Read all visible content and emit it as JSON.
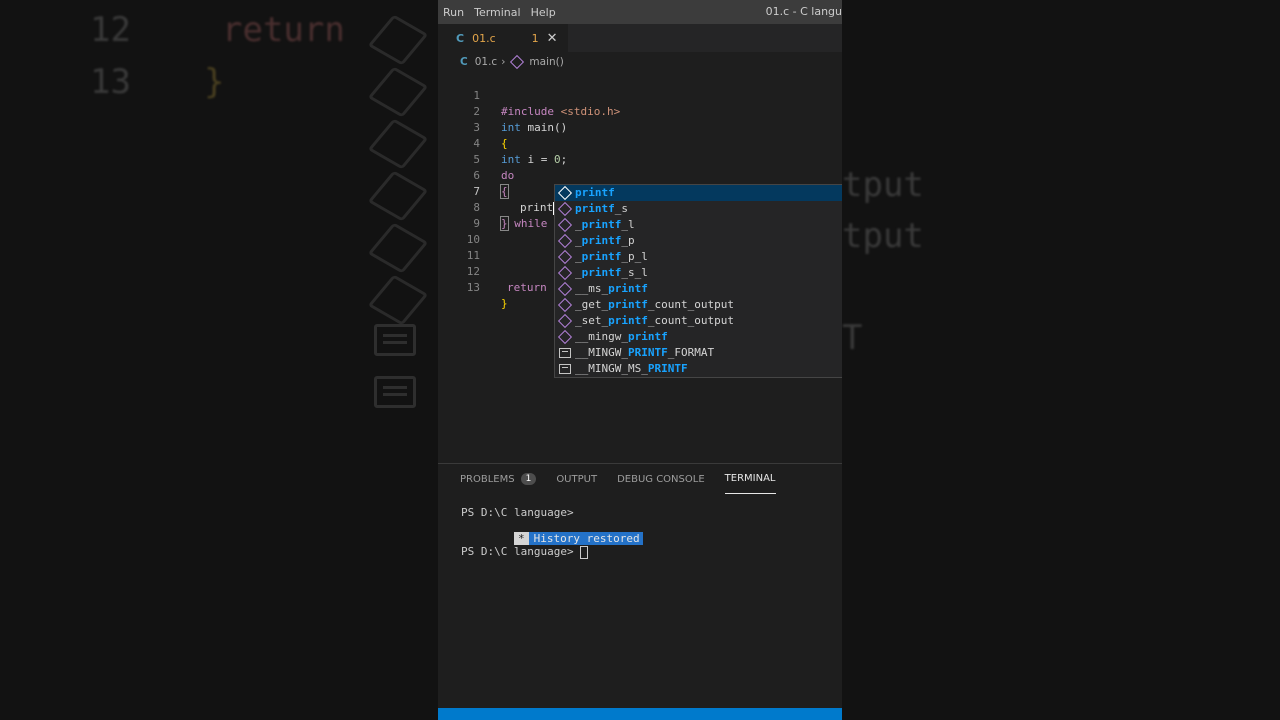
{
  "background": {
    "left_code": [
      "12",
      "return",
      "13",
      "}"
    ],
    "right_words": [
      "tput",
      "tput",
      "T"
    ]
  },
  "menubar": {
    "items": [
      "Run",
      "Terminal",
      "Help"
    ],
    "title": "01.c - C langu"
  },
  "tab": {
    "lang_icon": "C",
    "name": "01.c",
    "problems": "1",
    "close": "✕"
  },
  "breadcrumb": {
    "lang_icon": "C",
    "file": "01.c",
    "sep": "›",
    "symbol": "main()"
  },
  "editor": {
    "lines": [
      {
        "n": "1"
      },
      {
        "n": "2"
      },
      {
        "n": "3"
      },
      {
        "n": "4"
      },
      {
        "n": "5"
      },
      {
        "n": "6"
      },
      {
        "n": "7"
      },
      {
        "n": "8"
      },
      {
        "n": "9"
      },
      {
        "n": "10"
      },
      {
        "n": "11"
      },
      {
        "n": "12"
      },
      {
        "n": "13"
      }
    ],
    "tokens": {
      "include": "#include",
      "header": "<stdio.h>",
      "int": "int",
      "main": "main()",
      "open_brace": "{",
      "int2": "int",
      "decl": "i = ",
      "zero": "0",
      "semi": ";",
      "do": "do",
      "open_brace2": "{",
      "typed": "print",
      "close_brace2": "}",
      "while": "while",
      "return": "return",
      "close_brace": "}"
    }
  },
  "suggest": {
    "items": [
      {
        "pre": "",
        "hl": "printf",
        "post": "",
        "icon": "cube-icon",
        "selected": true
      },
      {
        "pre": "",
        "hl": "printf",
        "post": "_s",
        "icon": "cube-icon"
      },
      {
        "pre": "_",
        "hl": "printf",
        "post": "_l",
        "icon": "cube-icon"
      },
      {
        "pre": "_",
        "hl": "printf",
        "post": "_p",
        "icon": "cube-icon"
      },
      {
        "pre": "_",
        "hl": "printf",
        "post": "_p_l",
        "icon": "cube-icon"
      },
      {
        "pre": "_",
        "hl": "printf",
        "post": "_s_l",
        "icon": "cube-icon"
      },
      {
        "pre": "__ms_",
        "hl": "printf",
        "post": "",
        "icon": "cube-icon"
      },
      {
        "pre": "_get_",
        "hl": "printf",
        "post": "_count_output",
        "icon": "cube-icon"
      },
      {
        "pre": "_set_",
        "hl": "printf",
        "post": "_count_output",
        "icon": "cube-icon"
      },
      {
        "pre": "__mingw_",
        "hl": "printf",
        "post": "",
        "icon": "cube-icon"
      },
      {
        "pre": "__MINGW_",
        "hl": "PRINTF",
        "post": "_FORMAT",
        "icon": "list-icon"
      },
      {
        "pre": "__MINGW_MS_",
        "hl": "PRINTF",
        "post": "",
        "icon": "list-icon"
      }
    ]
  },
  "panel": {
    "tabs": [
      {
        "label": "PROBLEMS",
        "badge": "1"
      },
      {
        "label": "OUTPUT"
      },
      {
        "label": "DEBUG CONSOLE"
      },
      {
        "label": "TERMINAL",
        "active": true
      }
    ],
    "terminal": {
      "prompt1": "PS D:\\C language>",
      "restored_star": "*",
      "restored_text": "History restored",
      "prompt2": "PS D:\\C language> "
    }
  },
  "colors": {
    "accent": "#007acc",
    "selection": "#04395e",
    "match": "#18a3ff"
  }
}
